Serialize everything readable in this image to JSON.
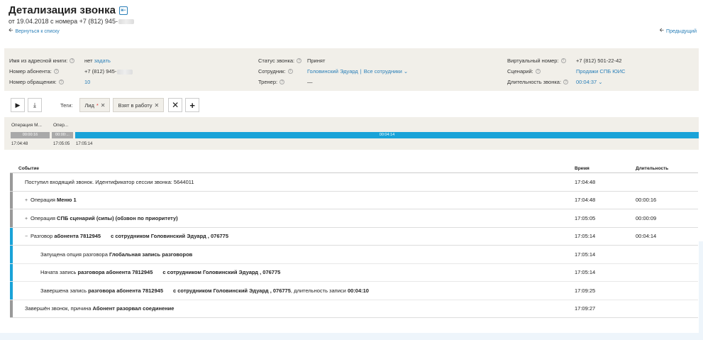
{
  "header": {
    "title": "Детализация звонка",
    "subtitle": "от 19.04.2018 с номера +7 (812) 945-"
  },
  "nav": {
    "back": "Вернуться к списку",
    "prev": "Предыдущий"
  },
  "info": {
    "address_book_label": "Имя из адресной книги:",
    "address_book_value": "нет",
    "address_book_link": "задать",
    "subscriber_label": "Номер абонента:",
    "subscriber_value": "+7 (812) 945-",
    "request_label": "Номер обращения:",
    "request_value": "10",
    "status_label": "Статус звонка:",
    "status_value": "Принят",
    "employee_label": "Сотрудник:",
    "employee_value": "Головинский Эдуард",
    "employee_all": "Все сотрудники",
    "trainer_label": "Тренер:",
    "trainer_value": "—",
    "virtual_label": "Виртуальный номер:",
    "virtual_value": "+7 (812) 501-22-42",
    "scenario_label": "Сценарий:",
    "scenario_value": "Продажи СПБ ЮИС",
    "duration_label": "Длительность звонка:",
    "duration_value": "00:04:37"
  },
  "controls": {
    "tags_label": "Теги:",
    "tags": [
      {
        "label": "Лид",
        "marker": "*"
      },
      {
        "label": "Взят в работу",
        "marker": ""
      }
    ]
  },
  "timeline": {
    "segments": [
      {
        "label": "Операция М...",
        "duration": "00:00:16",
        "start": "17:04:48",
        "color": "gray"
      },
      {
        "label": "Опер...",
        "duration": "00:00:...",
        "start": "17:05:05",
        "color": "gray"
      },
      {
        "label": "",
        "duration": "00:04:14",
        "start": "17:05:14",
        "color": "blue"
      }
    ]
  },
  "table": {
    "headers": {
      "event": "Событие",
      "time": "Время",
      "duration": "Длительность"
    },
    "rows": [
      {
        "parts": [
          {
            "t": "Поступил входящий звонок. Идентификатор сессии звонка: 5644011",
            "b": false
          }
        ],
        "time": "17:04:48",
        "duration": "",
        "expander": "",
        "child": false,
        "bar": "gray"
      },
      {
        "parts": [
          {
            "t": "Операция ",
            "b": false
          },
          {
            "t": "Меню 1",
            "b": true
          }
        ],
        "time": "17:04:48",
        "duration": "00:00:16",
        "expander": "+",
        "child": false,
        "bar": "gray"
      },
      {
        "parts": [
          {
            "t": "Операция ",
            "b": false
          },
          {
            "t": "СПБ сценарий (сипы) (обзвон по приоритету)",
            "b": true
          }
        ],
        "time": "17:05:05",
        "duration": "00:00:09",
        "expander": "+",
        "child": false,
        "bar": "gray"
      },
      {
        "parts": [
          {
            "t": "Разговор ",
            "b": false
          },
          {
            "t": "абонента 7812945",
            "b": true
          },
          {
            "t": "GAP",
            "b": false
          },
          {
            "t": "с сотрудником Головинский Эдуард , 076775",
            "b": true
          }
        ],
        "time": "17:05:14",
        "duration": "00:04:14",
        "expander": "−",
        "child": false,
        "bar": "blue"
      },
      {
        "parts": [
          {
            "t": "Запущена опция разговора ",
            "b": false
          },
          {
            "t": "Глобальная запись разговоров",
            "b": true
          }
        ],
        "time": "17:05:14",
        "duration": "",
        "expander": "",
        "child": true,
        "bar": "blue"
      },
      {
        "parts": [
          {
            "t": "Начата запись ",
            "b": false
          },
          {
            "t": "разговора абонента 7812945",
            "b": true
          },
          {
            "t": "GAP",
            "b": false
          },
          {
            "t": "с сотрудником Головинский Эдуард , 076775",
            "b": true
          }
        ],
        "time": "17:05:14",
        "duration": "",
        "expander": "",
        "child": true,
        "bar": "blue"
      },
      {
        "parts": [
          {
            "t": "Завершена запись ",
            "b": false
          },
          {
            "t": "разговора абонента 7812945",
            "b": true
          },
          {
            "t": "GAP",
            "b": false
          },
          {
            "t": "с сотрудником Головинский Эдуард , 076775",
            "b": true
          },
          {
            "t": ", длительность записи ",
            "b": false
          },
          {
            "t": "00:04:10",
            "b": true
          }
        ],
        "time": "17:09:25",
        "duration": "",
        "expander": "",
        "child": true,
        "bar": "blue"
      },
      {
        "parts": [
          {
            "t": "Завершён звонок, причина ",
            "b": false
          },
          {
            "t": "Абонент разорвал соединение",
            "b": true
          }
        ],
        "time": "17:09:27",
        "duration": "",
        "expander": "",
        "child": false,
        "bar": "gray"
      }
    ]
  }
}
